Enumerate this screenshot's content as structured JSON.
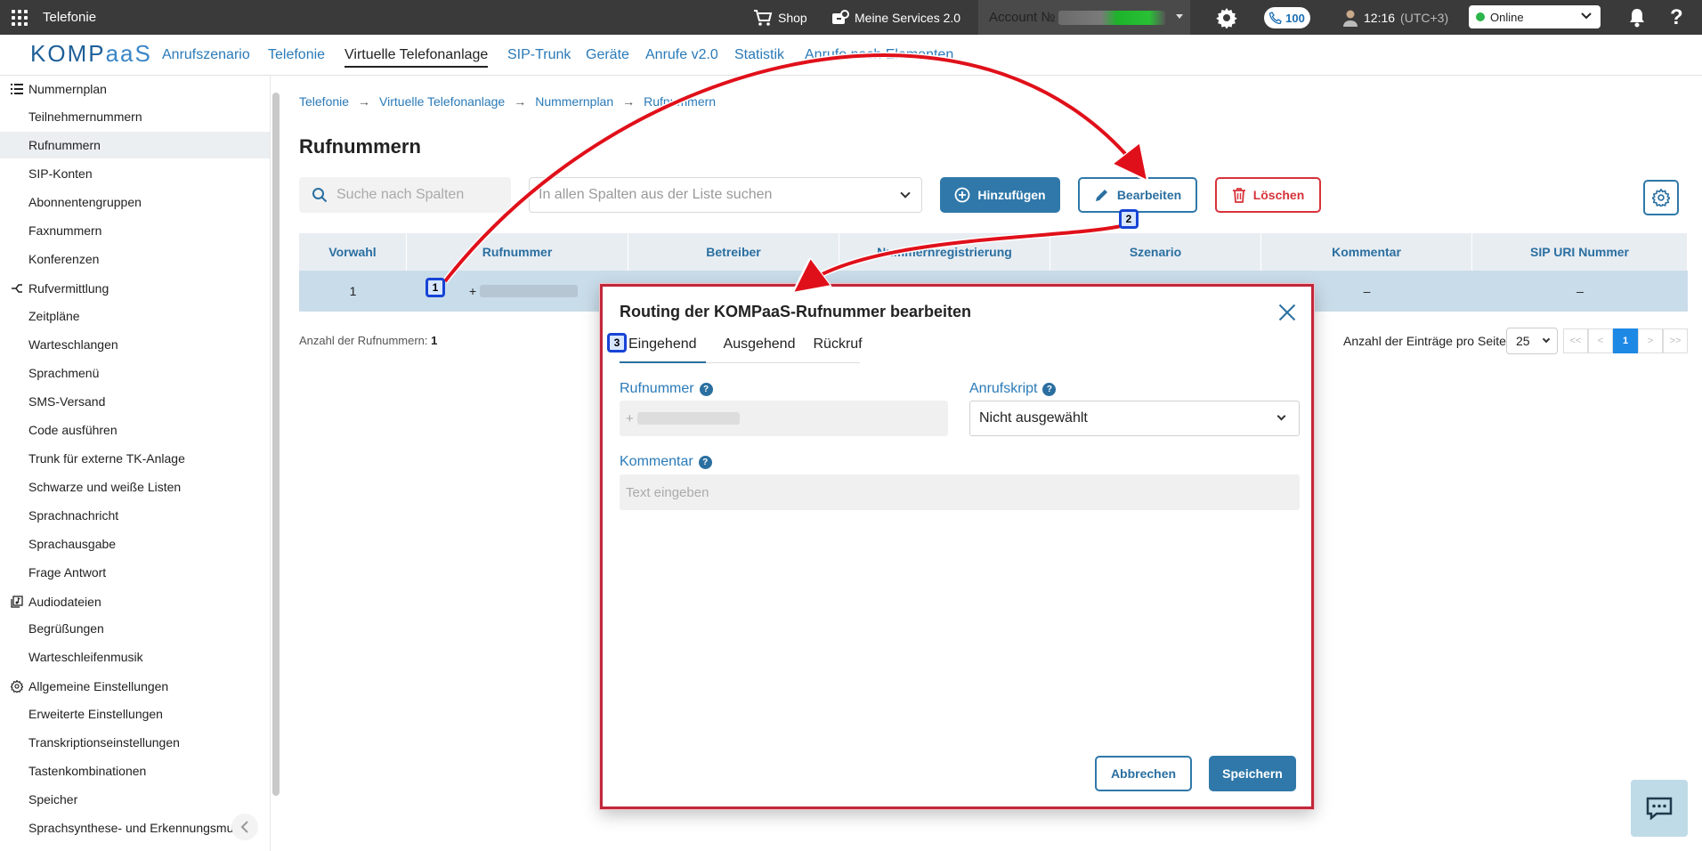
{
  "topbar": {
    "app_title": "Telefonie",
    "shop": "Shop",
    "services": "Meine Services 2.0",
    "account_label": "Account №",
    "calls_count": "100",
    "time": "12:16",
    "timezone": "(UTC+3)",
    "status": "Online",
    "help": "?"
  },
  "nav": {
    "logo_a": "KOMP",
    "logo_b": "aaS",
    "links": [
      "Anrufszenario",
      "Telefonie",
      "Virtuelle Telefonanlage",
      "SIP-Trunk",
      "Geräte",
      "Anrufe v2.0",
      "Statistik",
      "Anrufe nach Elementen"
    ]
  },
  "sidebar": {
    "sections": [
      "Nummernplan",
      "Rufvermittlung",
      "Audiodateien",
      "Allgemeine Einstellungen"
    ],
    "items": [
      "Teilnehmernummern",
      "Rufnummern",
      "SIP-Konten",
      "Abonnentengruppen",
      "Faxnummern",
      "Konferenzen",
      "Zeitpläne",
      "Warteschlangen",
      "Sprachmenü",
      "SMS-Versand",
      "Code ausführen",
      "Trunk für externe TK-Anlage",
      "Schwarze und weiße Listen",
      "Sprachnachricht",
      "Sprachausgabe",
      "Frage Antwort",
      "Begrüßungen",
      "Warteschleifenmusik",
      "Erweiterte Einstellungen",
      "Transkriptionseinstellungen",
      "Tastenkombinationen",
      "Speicher",
      "Sprachsynthese- und Erkennungsmus"
    ]
  },
  "breadcrumb": [
    "Telefonie",
    "Virtuelle Telefonanlage",
    "Nummernplan",
    "Rufnummern"
  ],
  "page": {
    "title": "Rufnummern",
    "search_placeholder": "Suche nach Spalten",
    "columns_placeholder": "In allen Spalten aus der Liste suchen",
    "add_label": "Hinzufügen",
    "edit_label": "Bearbeiten",
    "delete_label": "Löschen"
  },
  "table": {
    "headers": [
      "Vorwahl",
      "Rufnummer",
      "Betreiber",
      "Nummernregistrierung",
      "Szenario",
      "Kommentar",
      "SIP URI Nummer"
    ],
    "row": {
      "vorwahl": "1",
      "rufnummer_prefix": "+",
      "kommentar": "–",
      "sip_uri": "–"
    }
  },
  "footer": {
    "count_label": "Anzahl der Rufnummern:",
    "count_value": "1",
    "perpage_label": "Anzahl der Einträge pro Seite",
    "perpage_value": "25",
    "pager": [
      "<<",
      "<",
      "1",
      ">",
      ">>"
    ]
  },
  "modal": {
    "title": "Routing der KOMPaaS-Rufnummer bearbeiten",
    "tabs": [
      "Eingehend",
      "Ausgehend",
      "Rückruf"
    ],
    "rufnummer_label": "Rufnummer",
    "rufnummer_prefix": "+",
    "anrufskript_label": "Anrufskript",
    "anrufskript_value": "Nicht ausgewählt",
    "kommentar_label": "Kommentar",
    "kommentar_placeholder": "Text eingeben",
    "cancel_label": "Abbrechen",
    "save_label": "Speichern"
  },
  "markers": [
    "1",
    "2",
    "3"
  ],
  "colors": {
    "primary": "#2f78a9",
    "link": "#2a7ab8",
    "danger": "#d7333a",
    "annotation_red": "#e0101a",
    "marker_border": "#1744d6",
    "topbar_bg": "#3a3a3a"
  }
}
